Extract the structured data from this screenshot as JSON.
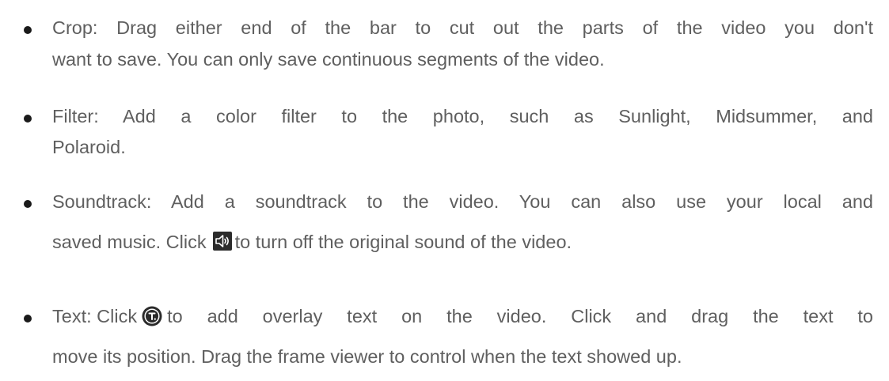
{
  "bullets": [
    {
      "line1": "Crop: Drag either end of the bar to cut out the parts of the video you don't",
      "line2": "want to save. You can only save continuous segments of the video."
    },
    {
      "line1": "Filter: Add a color filter to the photo, such as Sunlight, Midsummer, and",
      "line2": "Polaroid."
    },
    {
      "line1": "Soundtrack: Add a soundtrack to the video. You can also use your local and",
      "line2_before": "saved music. Click",
      "icon": "speaker-icon",
      "line2_after": "to turn off the original sound of the video."
    },
    {
      "line1_before": "Text: Click",
      "icon": "text-overlay-icon",
      "line1_after": "to add overlay text on the video. Click and drag the text to",
      "line2": "move its position. Drag the frame viewer to control when the text showed up."
    }
  ]
}
